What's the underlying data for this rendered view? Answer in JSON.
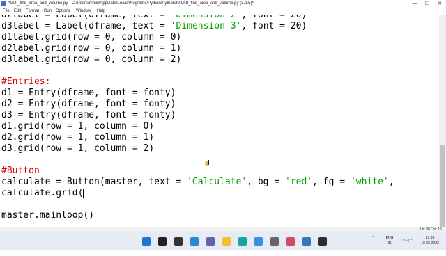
{
  "window": {
    "title": "*GUI_find_area_and_volume.py - C:/Users/mmiil/AppData/Local/Programs/Python/Python39/GUI_find_area_and_volume.py (3.9.5)*",
    "minimize_glyph": "—",
    "maximize_glyph": "☐",
    "close_glyph": "✕"
  },
  "menu": {
    "items": [
      {
        "label": "File"
      },
      {
        "label": "Edit"
      },
      {
        "label": "Format"
      },
      {
        "label": "Run"
      },
      {
        "label": "Options"
      },
      {
        "label": "Window"
      },
      {
        "label": "Help"
      }
    ]
  },
  "code": {
    "lines": [
      {
        "parts": [
          {
            "text": "d2label = Label(dframe, text = ",
            "cls": ""
          },
          {
            "text": "'Dimension 2'",
            "cls": "str"
          },
          {
            "text": ", font = 20)",
            "cls": ""
          }
        ]
      },
      {
        "parts": [
          {
            "text": "d3label = Label(dframe, text = ",
            "cls": ""
          },
          {
            "text": "'Dimension 3'",
            "cls": "str"
          },
          {
            "text": ", font = 20)",
            "cls": ""
          }
        ]
      },
      {
        "parts": [
          {
            "text": "d1label.grid(row = 0, column = 0)",
            "cls": ""
          }
        ]
      },
      {
        "parts": [
          {
            "text": "d2label.grid(row = 0, column = 1)",
            "cls": ""
          }
        ]
      },
      {
        "parts": [
          {
            "text": "d3label.grid(row = 0, column = 2)",
            "cls": ""
          }
        ]
      },
      {
        "parts": [
          {
            "text": "",
            "cls": ""
          }
        ]
      },
      {
        "parts": [
          {
            "text": "#Entries:",
            "cls": "cmt"
          }
        ]
      },
      {
        "parts": [
          {
            "text": "d1 = Entry(dframe, font = fonty)",
            "cls": ""
          }
        ]
      },
      {
        "parts": [
          {
            "text": "d2 = Entry(dframe, font = fonty)",
            "cls": ""
          }
        ]
      },
      {
        "parts": [
          {
            "text": "d3 = Entry(dframe, font = fonty)",
            "cls": ""
          }
        ]
      },
      {
        "parts": [
          {
            "text": "d1.grid(row = 1, column = 0)",
            "cls": ""
          }
        ]
      },
      {
        "parts": [
          {
            "text": "d2.grid(row = 1, column = 1)",
            "cls": ""
          }
        ]
      },
      {
        "parts": [
          {
            "text": "d3.grid(row = 1, column = 2)",
            "cls": ""
          }
        ]
      },
      {
        "parts": [
          {
            "text": "",
            "cls": ""
          }
        ]
      },
      {
        "parts": [
          {
            "text": "#Button",
            "cls": "cmt"
          }
        ]
      },
      {
        "parts": [
          {
            "text": "calculate = Button(master, text = ",
            "cls": ""
          },
          {
            "text": "'Calculate'",
            "cls": "str"
          },
          {
            "text": ", bg = ",
            "cls": ""
          },
          {
            "text": "'red'",
            "cls": "str"
          },
          {
            "text": ", fg = ",
            "cls": ""
          },
          {
            "text": "'white'",
            "cls": "str"
          },
          {
            "text": ",",
            "cls": ""
          }
        ]
      },
      {
        "parts": [
          {
            "text": "calculate.grid(",
            "cls": ""
          }
        ],
        "cursor": true
      },
      {
        "parts": [
          {
            "text": "",
            "cls": ""
          }
        ]
      },
      {
        "parts": [
          {
            "text": "master.mainloop()",
            "cls": ""
          }
        ]
      }
    ]
  },
  "status": {
    "position": "Ln: 38   Col: 15"
  },
  "taskbar": {
    "icons": [
      {
        "name": "windows-start-icon",
        "color": "#1f74d6"
      },
      {
        "name": "search-icon",
        "color": "#222222"
      },
      {
        "name": "task-view-icon",
        "color": "#333333"
      },
      {
        "name": "widgets-icon",
        "color": "#2b88d8"
      },
      {
        "name": "teams-chat-icon",
        "color": "#6264a7"
      },
      {
        "name": "file-explorer-icon",
        "color": "#f2c12e"
      },
      {
        "name": "edge-browser-icon",
        "color": "#1aa39c"
      },
      {
        "name": "microsoft-store-icon",
        "color": "#3a8ee6"
      },
      {
        "name": "settings-icon",
        "color": "#666666"
      },
      {
        "name": "photos-icon",
        "color": "#d04a6a"
      },
      {
        "name": "python-idle-icon",
        "color": "#3b73b9"
      },
      {
        "name": "terminal-icon",
        "color": "#2d2d2d"
      }
    ],
    "tray": {
      "language": "ENG",
      "region": "IN",
      "time": "19:38",
      "date": "10-03-2022"
    }
  }
}
